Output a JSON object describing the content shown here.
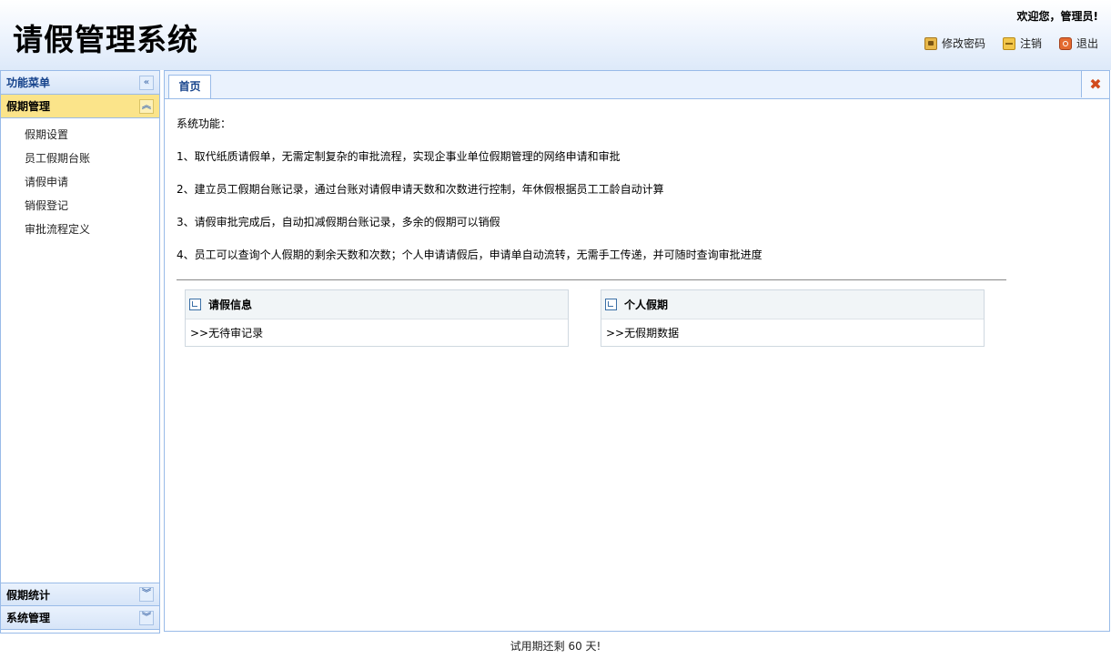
{
  "header": {
    "title": "请假管理系统",
    "welcome": "欢迎您，管理员!",
    "links": [
      {
        "label": "修改密码",
        "icon": "lock-icon"
      },
      {
        "label": "注销",
        "icon": "key-icon"
      },
      {
        "label": "退出",
        "icon": "power-icon"
      }
    ]
  },
  "sidebar": {
    "title": "功能菜单",
    "collapse_glyph": "«",
    "sections": [
      {
        "label": "假期管理",
        "glyph": "︽",
        "items": [
          "假期设置",
          "员工假期台账",
          "请假申请",
          "销假登记",
          "审批流程定义"
        ]
      },
      {
        "label": "假期统计",
        "glyph": "︾"
      },
      {
        "label": "系统管理",
        "glyph": "︾"
      }
    ]
  },
  "tabs": {
    "active": "首页",
    "close_glyph": "✖"
  },
  "home": {
    "intro": "系统功能：",
    "features": [
      "1、取代纸质请假单，无需定制复杂的审批流程，实现企事业单位假期管理的网络申请和审批",
      "2、建立员工假期台账记录，通过台账对请假申请天数和次数进行控制，年休假根据员工工龄自动计算",
      "3、请假审批完成后，自动扣减假期台账记录，多余的假期可以销假",
      "4、员工可以查询个人假期的剩余天数和次数；个人申请请假后，申请单自动流转，无需手工传递，并可随时查询审批进度"
    ],
    "boxes": [
      {
        "title": "请假信息",
        "body": ">>无待审记录"
      },
      {
        "title": "个人假期",
        "body": ">>无假期数据"
      }
    ]
  },
  "footer": {
    "text": "试用期还剩 60 天!"
  }
}
